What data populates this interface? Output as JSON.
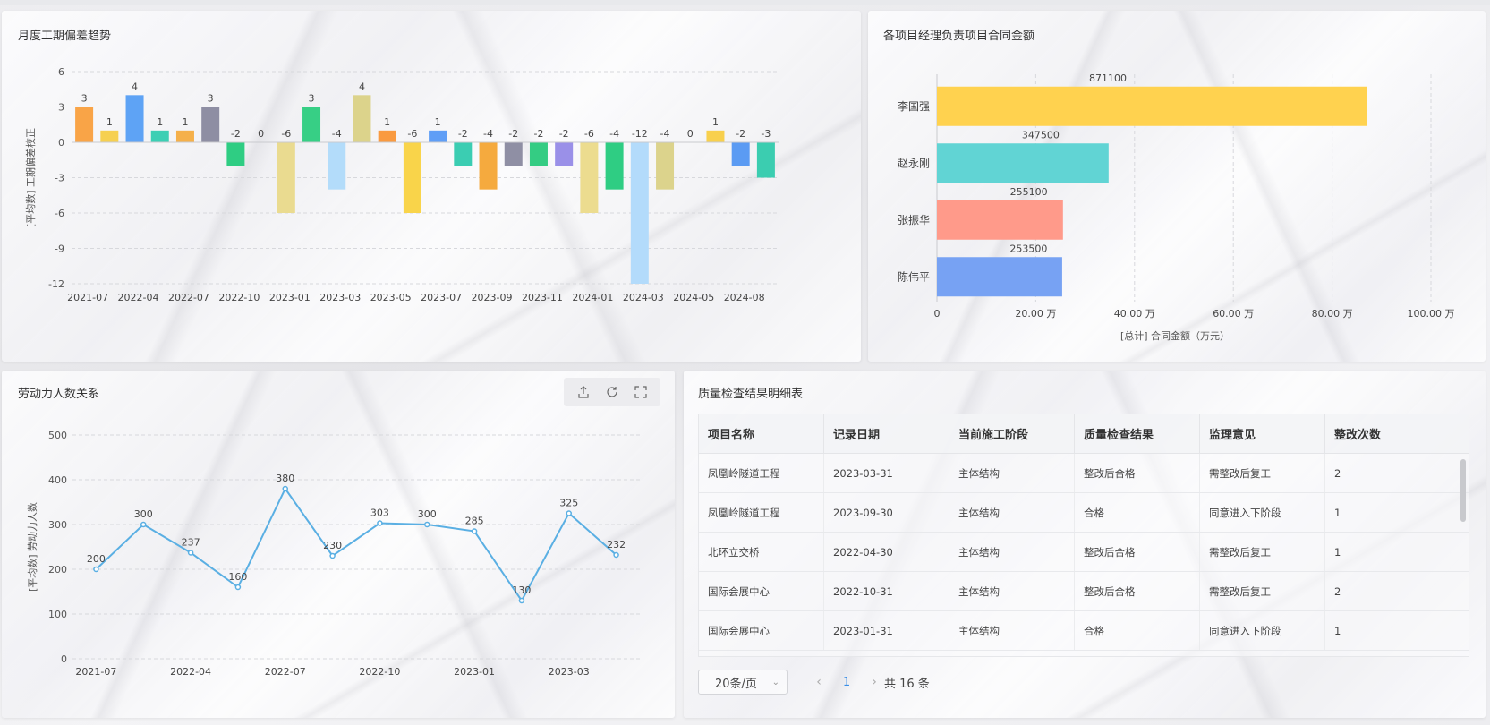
{
  "colors": {
    "accent": "#3a8ee6",
    "line": "#5aafe3",
    "grid": "#d7d8dc"
  },
  "cards": {
    "deviation": {
      "title": "月度工期偏差趋势"
    },
    "manager": {
      "title": "各项目经理负责项目合同金额"
    },
    "labor": {
      "title": "劳动力人数关系"
    },
    "quality": {
      "title": "质量检查结果明细表"
    }
  },
  "toolbar": {
    "icons": [
      "export-icon",
      "refresh-icon",
      "fullscreen-icon"
    ]
  },
  "chart_data": [
    {
      "type": "bar",
      "title": "月度工期偏差趋势",
      "ylabel": "[平均数] 工期偏差校正",
      "xlabel": "",
      "ylim": [
        -12,
        6
      ],
      "yticks": [
        6,
        3,
        0,
        -3,
        -6,
        -9,
        -12
      ],
      "grid": true,
      "x_tick_labels": [
        "2021-07",
        "2022-04",
        "2022-07",
        "2022-10",
        "2023-01",
        "2023-03",
        "2023-05",
        "2023-07",
        "2023-09",
        "2023-11",
        "2024-01",
        "2024-03",
        "2024-05",
        "2024-08"
      ],
      "values": [
        3,
        1,
        4,
        1,
        1,
        3,
        -2,
        0,
        -6,
        3,
        -4,
        4,
        1,
        -6,
        1,
        -2,
        -4,
        -2,
        -2,
        -2,
        -6,
        -4,
        -12,
        -4,
        0,
        1,
        -2,
        -3
      ],
      "bar_colors": [
        "#f9a447",
        "#f6d051",
        "#5ea3f5",
        "#3ccfb4",
        "#f5b04a",
        "#8e8ea3",
        "#2fcd83",
        "#e9d88d",
        "#eadb90",
        "#37cf85",
        "#b3dcfa",
        "#dcd38b",
        "#f99a40",
        "#f9d44a",
        "#5f9ef6",
        "#3bcdb2",
        "#f5aa3e",
        "#8f8fa4",
        "#34cc83",
        "#9a90e8",
        "#ecdc8f",
        "#2fcd83",
        "#b3dbfb",
        "#dcd38c",
        "#f5c34d",
        "#f8d04d",
        "#5b9bf3",
        "#3bcdb0"
      ]
    },
    {
      "type": "bar",
      "orientation": "horizontal",
      "title": "各项目经理负责项目合同金额",
      "categories": [
        "李国强",
        "赵永刚",
        "张振华",
        "陈伟平"
      ],
      "values": [
        871100,
        347500,
        255100,
        253500
      ],
      "value_labels": [
        "871100",
        "347500",
        "255100",
        "253500"
      ],
      "bar_colors": [
        "#ffd24f",
        "#61d4d4",
        "#ff9a8a",
        "#77a2f3"
      ],
      "xlim": [
        0,
        1000000
      ],
      "x_tick_labels": [
        "0",
        "20.00 万",
        "40.00 万",
        "60.00 万",
        "80.00 万",
        "100.00 万"
      ],
      "xlabel": "[总计] 合同金额（万元）",
      "grid": true
    },
    {
      "type": "line",
      "title": "劳动力人数关系",
      "ylabel": "[平均数] 劳动力人数",
      "ylim": [
        0,
        500
      ],
      "yticks": [
        500,
        400,
        300,
        200,
        100,
        0
      ],
      "x_tick_labels": [
        "2021-07",
        "2022-04",
        "2022-07",
        "2022-10",
        "2023-01",
        "2023-03"
      ],
      "values": [
        200,
        300,
        237,
        160,
        380,
        230,
        303,
        300,
        285,
        130,
        325,
        232
      ],
      "grid": true
    }
  ],
  "table": {
    "headers": [
      "项目名称",
      "记录日期",
      "当前施工阶段",
      "质量检查结果",
      "监理意见",
      "整改次数"
    ],
    "rows": [
      [
        "凤凰岭隧道工程",
        "2023-03-31",
        "主体结构",
        "整改后合格",
        "需整改后复工",
        "2"
      ],
      [
        "凤凰岭隧道工程",
        "2023-09-30",
        "主体结构",
        "合格",
        "同意进入下阶段",
        "1"
      ],
      [
        "北环立交桥",
        "2022-04-30",
        "主体结构",
        "整改后合格",
        "需整改后复工",
        "1"
      ],
      [
        "国际会展中心",
        "2022-10-31",
        "主体结构",
        "整改后合格",
        "需整改后复工",
        "2"
      ],
      [
        "国际会展中心",
        "2023-01-31",
        "主体结构",
        "合格",
        "同意进入下阶段",
        "1"
      ]
    ]
  },
  "pager": {
    "size": "20条/页",
    "page": "1",
    "total": "共 16 条"
  }
}
